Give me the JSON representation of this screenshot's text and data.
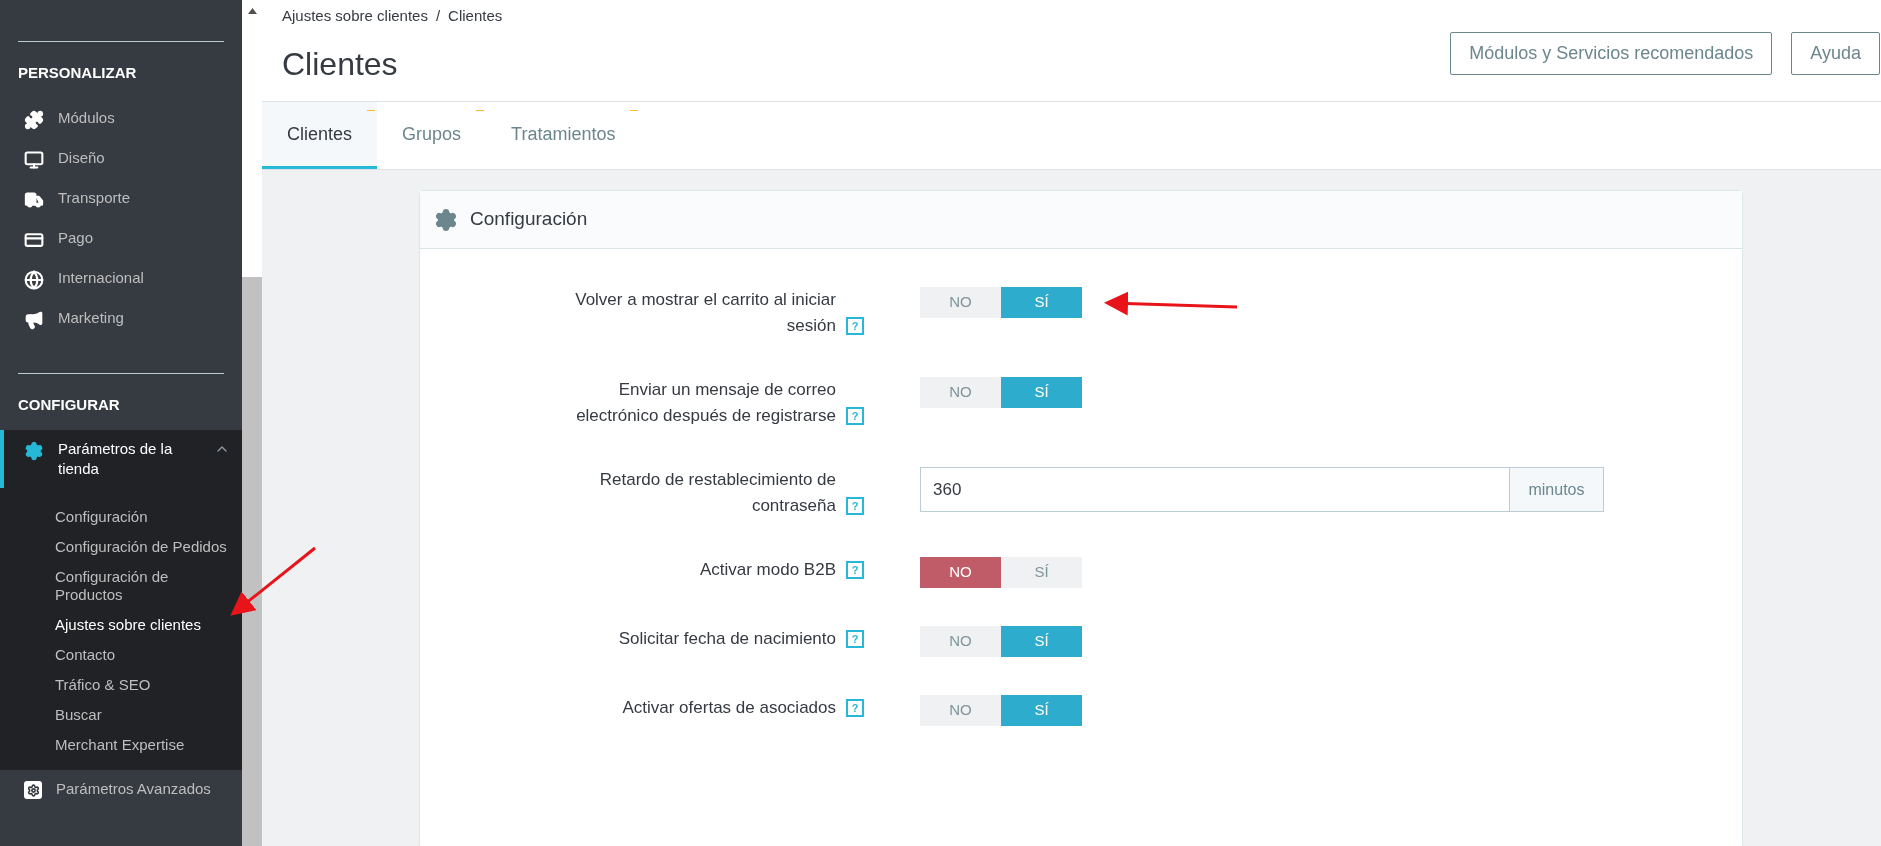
{
  "sidebar": {
    "sections": [
      {
        "title": "PERSONALIZAR",
        "items": [
          {
            "label": "Módulos",
            "selected": false
          },
          {
            "label": "Diseño",
            "selected": false
          },
          {
            "label": "Transporte",
            "selected": false
          },
          {
            "label": "Pago",
            "selected": false
          },
          {
            "label": "Internacional",
            "selected": false
          },
          {
            "label": "Marketing",
            "selected": false
          }
        ]
      },
      {
        "title": "CONFIGURAR",
        "items": [
          {
            "label": "Parámetros de la tienda",
            "selected": true,
            "expanded": true,
            "children": [
              {
                "label": "Configuración",
                "selected": false
              },
              {
                "label": "Configuración de Pedidos",
                "selected": false
              },
              {
                "label": "Configuración de Productos",
                "selected": false
              },
              {
                "label": "Ajustes sobre clientes",
                "selected": true
              },
              {
                "label": "Contacto",
                "selected": false
              },
              {
                "label": "Tráfico & SEO",
                "selected": false
              },
              {
                "label": "Buscar",
                "selected": false
              },
              {
                "label": "Merchant Expertise",
                "selected": false
              }
            ]
          },
          {
            "label": "Parámetros Avanzados",
            "selected": false
          }
        ]
      }
    ]
  },
  "breadcrumb": [
    "Ajustes sobre clientes",
    "Clientes"
  ],
  "breadcrumb_separator": "/",
  "page_title": "Clientes",
  "header_buttons": [
    "Módulos y Servicios recomendados",
    "Ayuda"
  ],
  "tabs": [
    {
      "label": "Clientes",
      "selected": true
    },
    {
      "label": "Grupos",
      "selected": false
    },
    {
      "label": "Tratamientos",
      "selected": false
    }
  ],
  "panel": {
    "title": "Configuración",
    "rows": [
      {
        "kind": "toggle",
        "label": "Volver a mostrar el carrito al iniciar sesión",
        "help": "?",
        "options": [
          {
            "label": "NO",
            "selected": false
          },
          {
            "label": "SÍ",
            "selected": true
          }
        ]
      },
      {
        "kind": "toggle",
        "label": "Enviar un mensaje de correo electrónico después de registrarse",
        "help": "?",
        "options": [
          {
            "label": "NO",
            "selected": false
          },
          {
            "label": "SÍ",
            "selected": true
          }
        ]
      },
      {
        "kind": "input",
        "label": "Retardo de restablecimiento de contraseña",
        "help": "?",
        "value": "360",
        "suffix": "minutos"
      },
      {
        "kind": "toggle",
        "label": "Activar modo B2B",
        "help": "?",
        "options": [
          {
            "label": "NO",
            "selected": true
          },
          {
            "label": "SÍ",
            "selected": false
          }
        ]
      },
      {
        "kind": "toggle",
        "label": "Solicitar fecha de nacimiento",
        "help": "?",
        "options": [
          {
            "label": "NO",
            "selected": false
          },
          {
            "label": "SÍ",
            "selected": true
          }
        ]
      },
      {
        "kind": "toggle",
        "label": "Activar ofertas de asociados",
        "help": "?",
        "options": [
          {
            "label": "NO",
            "selected": false
          },
          {
            "label": "SÍ",
            "selected": true
          }
        ]
      }
    ]
  }
}
